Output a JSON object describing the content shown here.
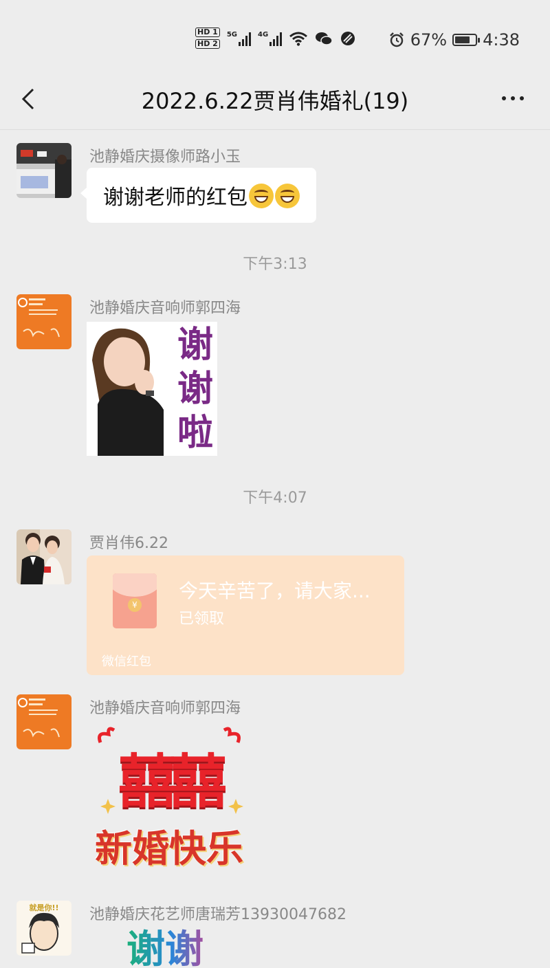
{
  "status_bar": {
    "battery": "67%",
    "time": "4:38",
    "network_1": "5G",
    "network_2": "4G",
    "hd_1": "HD 1",
    "hd_2": "HD 2"
  },
  "nav": {
    "title": "2022.6.22贾肖伟婚礼(19)"
  },
  "messages": [
    {
      "sender": "池静婚庆摄像师路小玉",
      "text": "谢谢老师的红包",
      "emoji": "grinning-face"
    },
    {
      "time": "下午3:13"
    },
    {
      "sender": "池静婚庆音响师郭四海",
      "sticker_text": [
        "谢",
        "谢",
        "啦"
      ]
    },
    {
      "time": "下午4:07"
    },
    {
      "sender": "贾肖伟6.22",
      "red_packet": {
        "title": "今天辛苦了，请大家...",
        "status": "已领取",
        "footer": "微信红包"
      }
    },
    {
      "sender": "池静婚庆音响师郭四海",
      "sticker_text": [
        "囍囍",
        "新婚快乐"
      ]
    },
    {
      "sender": "池静婚庆花艺师唐瑞芳13930047682",
      "avatar_text": "就是你!!",
      "sticker_text": [
        "谢谢"
      ]
    }
  ],
  "colors": {
    "background": "#ededed",
    "red_packet": "#fde2c8",
    "sticker_red": "#e8232a"
  }
}
